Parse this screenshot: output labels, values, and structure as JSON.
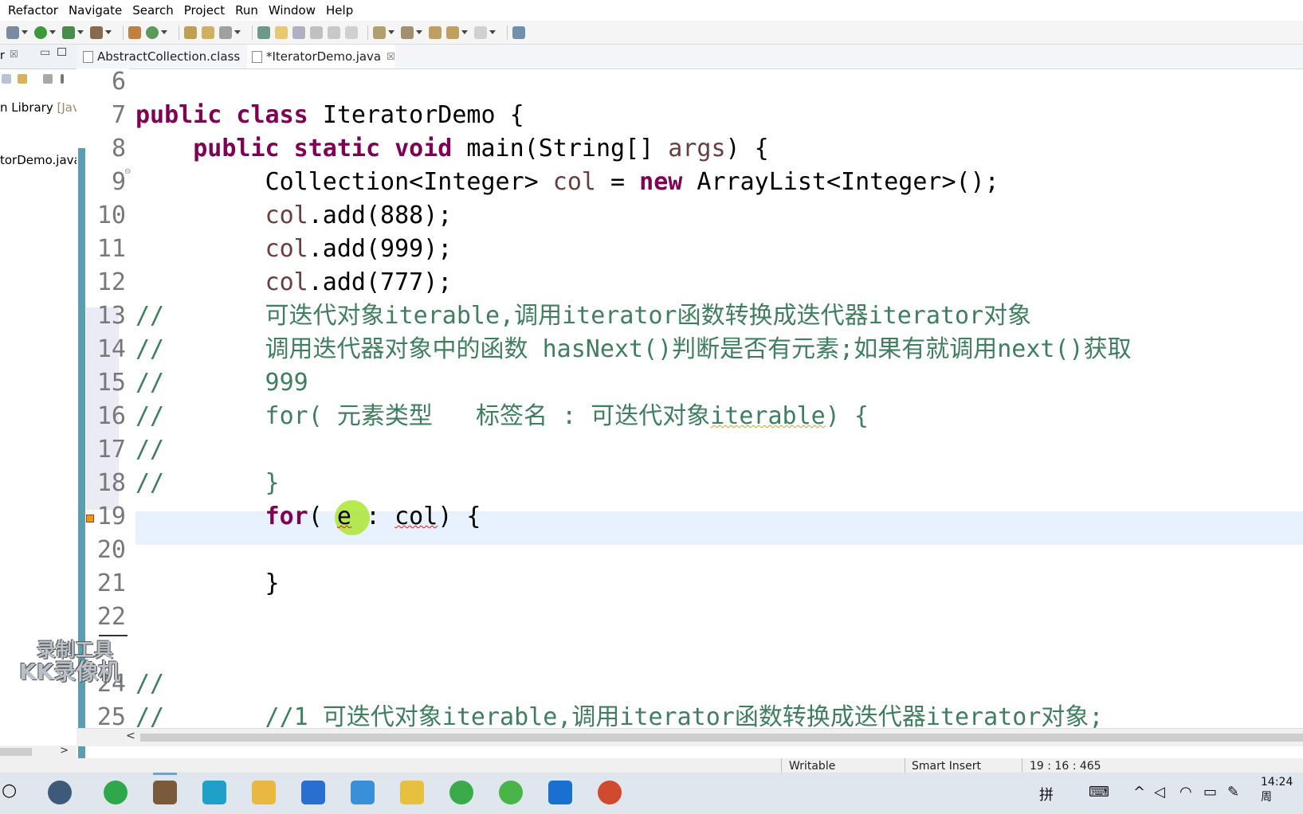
{
  "menubar": {
    "items": [
      "Refactor",
      "Navigate",
      "Search",
      "Project",
      "Run",
      "Window",
      "Help"
    ]
  },
  "left_panel": {
    "tab_label": "r",
    "items": [
      {
        "text": "n Library ",
        "dim": "[Java"
      },
      {
        "text": "torDemo.java",
        "dim": ""
      }
    ]
  },
  "tabs": [
    {
      "label": "AbstractCollection.class",
      "active": false
    },
    {
      "label": "*IteratorDemo.java",
      "active": true
    }
  ],
  "line_numbers": [
    "6",
    "7",
    "8",
    "9",
    "10",
    "11",
    "12",
    "13",
    "14",
    "15",
    "16",
    "17",
    "18",
    "19",
    "20",
    "21",
    "22",
    "23",
    "24",
    "25"
  ],
  "code": {
    "l7_kw": "public class ",
    "l7_rest": "IteratorDemo {",
    "l8_indent": "    ",
    "l8_kw": "public static void ",
    "l8_mid": "main(String[] ",
    "l8_var": "args",
    "l8_end": ") {",
    "l9_indent": "         ",
    "l9_a": "Collection<Integer> ",
    "l9_var": "col",
    "l9_b": " = ",
    "l9_kw": "new",
    "l9_c": " ArrayList<Integer>();",
    "l10_var": "col",
    "l10_rest": ".add(888);",
    "l11_var": "col",
    "l11_rest": ".add(999);",
    "l12_var": "col",
    "l12_rest": ".add(777);",
    "l13": "//       可迭代对象iterable,调用iterator函数转换成迭代器iterator对象",
    "l14": "//       调用迭代器对象中的函数 hasNext()判断是否有元素;如果有就调用next()获取",
    "l15": "//       999",
    "l16_a": "//       for( 元素类型   标签名 : 可迭代对象",
    "l16_sq": "iterable",
    "l16_b": ") {",
    "l17": "//",
    "l18": "//       }",
    "l19_indent": "         ",
    "l19_kw": "for",
    "l19_a": "( ",
    "l19_cursor": "e",
    "l19_b": " : ",
    "l19_sq": "col",
    "l19_c": ") {",
    "l21": "         }",
    "l24": "//",
    "l25": "//       //1 可迭代对象iterable,调用iterator函数转换成迭代器iterator对象;"
  },
  "statusbar": {
    "writable": "Writable",
    "insert_mode": "Smart Insert",
    "position": "19 : 16 : 465"
  },
  "taskbar": {
    "ime": "拼",
    "clock": "14:24 周"
  },
  "watermark": {
    "line1": "录制工具",
    "line2": "KK录像机"
  },
  "colors": {
    "keyword": "#7f0055",
    "comment": "#3f7f5f",
    "variable": "#6a3e3e",
    "current_line": "#e8f2fe"
  }
}
